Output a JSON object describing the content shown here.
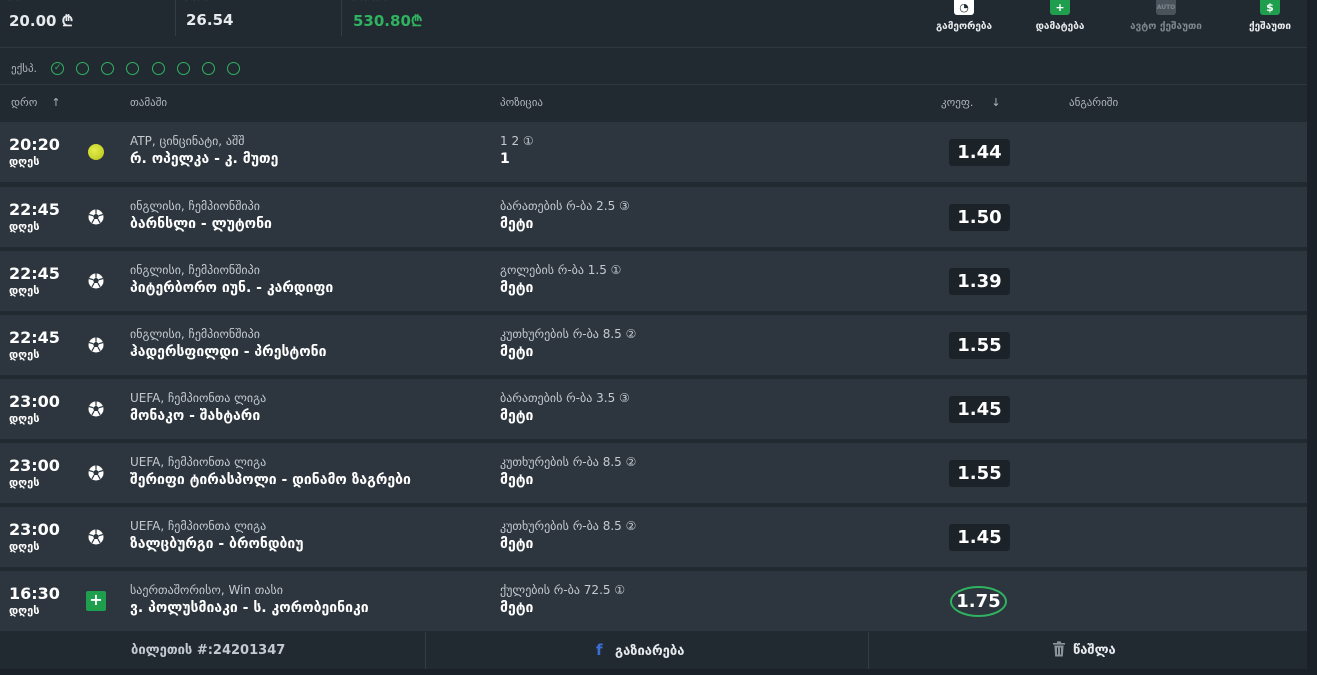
{
  "summary": {
    "stake_value": "20.00 ₾",
    "total_odds_value": "26.54",
    "potential_win_value": "530.80₾",
    "accent_color": "#2fb360"
  },
  "actions": [
    {
      "label": "გამეორება",
      "icon": "clock-icon"
    },
    {
      "label": "დამატება",
      "icon": "plus-icon"
    },
    {
      "label": "ავტო ქეშაუთი",
      "icon": "auto-icon"
    },
    {
      "label": "ქეშაუთი",
      "icon": "dollar-icon"
    }
  ],
  "express": {
    "label": "ექსპ.",
    "checked_count": 1,
    "total": 8
  },
  "table_headers": {
    "date": "დრო",
    "game": "თამაში",
    "position": "პოზიცია",
    "odds": "კოეფ.",
    "result": "ანგარიში"
  },
  "rows": [
    {
      "time": "20:20",
      "day": "დღეს",
      "sport": "tennis-ball-icon",
      "league": "ATP, ცინცინატი, აშშ",
      "teams": "რ. ოპელკა - კ. მუთე",
      "market": "1 2 ①",
      "pick": "1",
      "odd": "1.44",
      "highlight": false
    },
    {
      "time": "22:45",
      "day": "დღეს",
      "sport": "soccer-ball-icon",
      "league": "ინგლისი, ჩემპიონშიპი",
      "teams": "ბარნსლი - ლუტონი",
      "market": "ბარათების რ-ბა 2.5 ③",
      "pick": "მეტი",
      "odd": "1.50",
      "highlight": false
    },
    {
      "time": "22:45",
      "day": "დღეს",
      "sport": "soccer-ball-icon",
      "league": "ინგლისი, ჩემპიონშიპი",
      "teams": "პიტერბორო იუნ. - კარდიფი",
      "market": "გოლების რ-ბა 1.5 ①",
      "pick": "მეტი",
      "odd": "1.39",
      "highlight": false
    },
    {
      "time": "22:45",
      "day": "დღეს",
      "sport": "soccer-ball-icon",
      "league": "ინგლისი, ჩემპიონშიპი",
      "teams": "ჰადერსფილდი - პრესტონი",
      "market": "კუთხურების რ-ბა 8.5 ②",
      "pick": "მეტი",
      "odd": "1.55",
      "highlight": false
    },
    {
      "time": "23:00",
      "day": "დღეს",
      "sport": "soccer-ball-icon",
      "league": "UEFA, ჩემპიონთა ლიგა",
      "teams": "მონაკო - შახტარი",
      "market": "ბარათების რ-ბა 3.5 ③",
      "pick": "მეტი",
      "odd": "1.45",
      "highlight": false
    },
    {
      "time": "23:00",
      "day": "დღეს",
      "sport": "soccer-ball-icon",
      "league": "UEFA, ჩემპიონთა ლიგა",
      "teams": "შერიფი ტირასპოლი - დინამო ზაგრები",
      "market": "კუთხურების რ-ბა 8.5 ②",
      "pick": "მეტი",
      "odd": "1.55",
      "highlight": false
    },
    {
      "time": "23:00",
      "day": "დღეს",
      "sport": "soccer-ball-icon",
      "league": "UEFA, ჩემპიონთა ლიგა",
      "teams": "ზალცბურგი - ბრონდბიუ",
      "market": "კუთხურების რ-ბა 8.5 ②",
      "pick": "მეტი",
      "odd": "1.45",
      "highlight": false
    },
    {
      "time": "16:30",
      "day": "დღეს",
      "sport": "plus-sport-icon",
      "league": "საერთაშორისო, Win თასი",
      "teams": "ვ. პოლუსმიაკი - ს. კორობეინიკი",
      "market": "ქულების რ-ბა 72.5 ①",
      "pick": "მეტი",
      "odd": "1.75",
      "highlight": true
    }
  ],
  "footer": {
    "ticket": "ბილეთის #:24201347",
    "share": "გაზიარება",
    "delete": "წაშლა"
  }
}
